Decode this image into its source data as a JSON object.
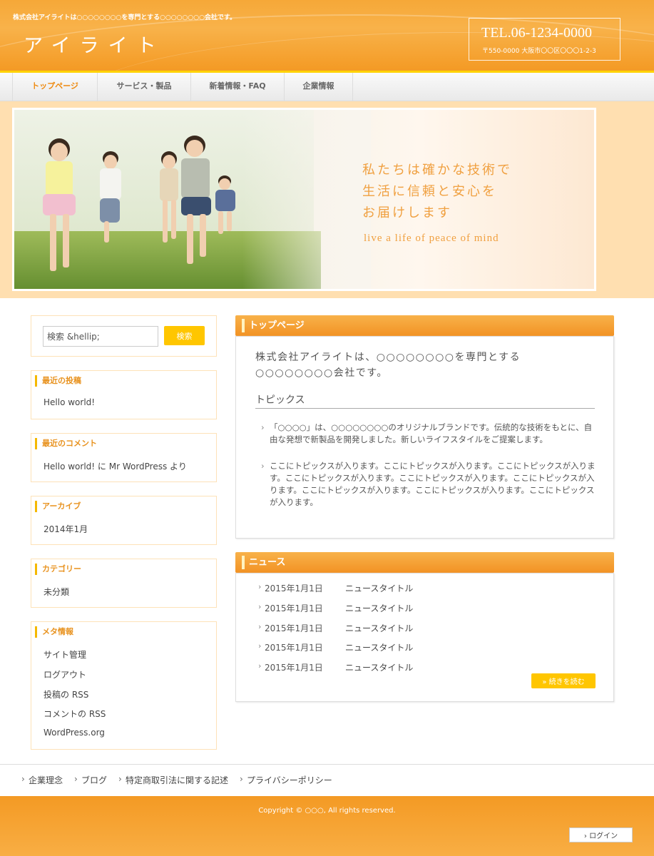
{
  "header": {
    "tagline": "株式会社アイライトは○○○○○○○○を専門とする○○○○○○○○会社です。",
    "site_title": "アイライト",
    "tel": "TEL.06-1234-0000",
    "address": "〒550-0000 大阪市〇〇区〇〇〇1-2-3"
  },
  "nav": {
    "items": [
      "トップページ",
      "サービス・製品",
      "新着情報・FAQ",
      "企業情報"
    ]
  },
  "hero": {
    "copy_line1": "私たちは確かな技術で",
    "copy_line2": "生活に信頼と安心を",
    "copy_line3": "お届けします",
    "sub": "live a life of peace of mind"
  },
  "sidebar": {
    "search_value": "検索 &hellip;",
    "search_button": "検索",
    "recent_posts": {
      "title": "最近の投稿",
      "items": [
        "Hello world!"
      ]
    },
    "recent_comments": {
      "title": "最近のコメント",
      "items": [
        "Hello world! に Mr WordPress より"
      ]
    },
    "archives": {
      "title": "アーカイブ",
      "items": [
        "2014年1月"
      ]
    },
    "categories": {
      "title": "カテゴリー",
      "items": [
        "未分類"
      ]
    },
    "meta": {
      "title": "メタ情報",
      "items": [
        "サイト管理",
        "ログアウト",
        "投稿の RSS",
        "コメントの RSS",
        "WordPress.org"
      ]
    }
  },
  "main": {
    "top_title": "トップページ",
    "intro": "株式会社アイライトは、○○○○○○○○を専門とする○○○○○○○○会社です。",
    "topics_title": "トピックス",
    "topics": [
      "「○○○○」は、○○○○○○○○のオリジナルブランドです。伝統的な技術をもとに、自由な発想で新製品を開発しました。新しいライフスタイルをご提案します。",
      "ここにトピックスが入ります。ここにトピックスが入ります。ここにトピックスが入ります。ここにトピックスが入ります。ここにトピックスが入ります。ここにトピックスが入ります。ここにトピックスが入ります。ここにトピックスが入ります。ここにトピックスが入ります。"
    ],
    "news_title": "ニュース",
    "news": [
      {
        "date": "2015年1月1日",
        "title": "ニュースタイトル"
      },
      {
        "date": "2015年1月1日",
        "title": "ニュースタイトル"
      },
      {
        "date": "2015年1月1日",
        "title": "ニュースタイトル"
      },
      {
        "date": "2015年1月1日",
        "title": "ニュースタイトル"
      },
      {
        "date": "2015年1月1日",
        "title": "ニュースタイトル"
      }
    ],
    "more_label": "» 続きを読む"
  },
  "footer": {
    "links": [
      "企業理念",
      "ブログ",
      "特定商取引法に関する記述",
      "プライバシーポリシー"
    ],
    "copyright": "Copyright © ○○○, All rights reserved.",
    "login_label": "› ログイン"
  },
  "colors": {
    "accent": "#f49a24",
    "highlight": "#ffc600",
    "band": "#ffdfb0"
  }
}
